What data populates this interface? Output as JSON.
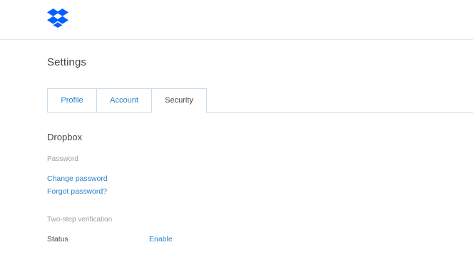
{
  "app": {
    "logo_icon": "dropbox-icon",
    "brand_color": "#0061fe",
    "link_color": "#2b82c9"
  },
  "page": {
    "title": "Settings"
  },
  "tabs": [
    {
      "label": "Profile",
      "active": false
    },
    {
      "label": "Account",
      "active": false
    },
    {
      "label": "Security",
      "active": true
    }
  ],
  "security": {
    "section_title": "Dropbox",
    "password": {
      "label": "Password",
      "change_link": "Change password",
      "forgot_link": "Forgot password?"
    },
    "two_step": {
      "label": "Two-step verification",
      "status_label": "Status",
      "status_action": "Enable"
    }
  }
}
